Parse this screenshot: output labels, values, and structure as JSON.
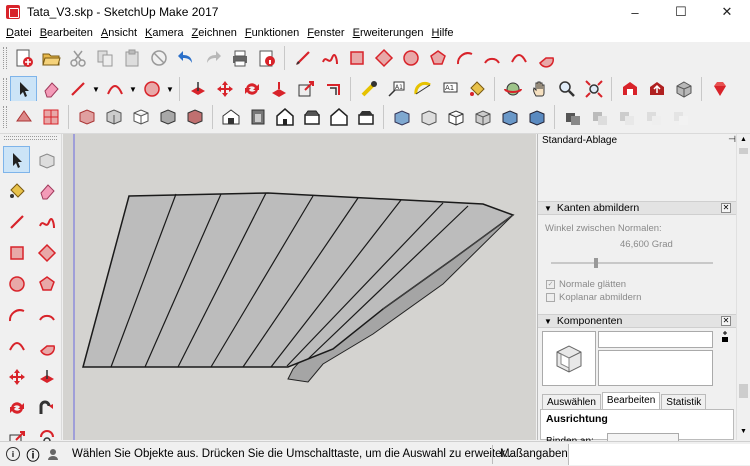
{
  "window": {
    "title": "Tata_V3.skp - SketchUp Make 2017",
    "min": "–",
    "max": "☐",
    "close": "✕"
  },
  "menu": [
    {
      "key": "D",
      "rest": "atei"
    },
    {
      "key": "B",
      "rest": "earbeiten"
    },
    {
      "key": "A",
      "rest": "nsicht"
    },
    {
      "key": "K",
      "rest": "amera"
    },
    {
      "key": "Z",
      "rest": "eichnen"
    },
    {
      "key": "F",
      "rest": "unktionen"
    },
    {
      "key": "F",
      "rest": "enster"
    },
    {
      "key": "E",
      "rest": "rweiterungen"
    },
    {
      "key": "H",
      "rest": "ilfe"
    }
  ],
  "panel": {
    "title": "Standard-Ablage",
    "pin": "⊣",
    "close": "✕",
    "soften": {
      "title": "Kanten abmildern",
      "angle_label": "Winkel zwischen Normalen:",
      "angle_value": "46,600  Grad",
      "smooth_normals": "Normale glätten",
      "soften_coplanar": "Koplanar abmildern"
    },
    "components": {
      "title": "Komponenten",
      "tabs": [
        "Auswählen",
        "Bearbeiten",
        "Statistik"
      ],
      "alignment_title": "Ausrichtung",
      "glue_label": "Binden an:"
    }
  },
  "status": {
    "text": "Wählen Sie Objekte aus. Drücken Sie die Umschalttaste, um die Auswahl zu erweiter...",
    "measure_label": "Maßangaben",
    "icon_info": "i",
    "icon_geo": "ⓘ"
  },
  "colors": {
    "accent": "#d8232a",
    "viewport_bg": "#d4d3d0",
    "face": "#b9b9b9"
  }
}
